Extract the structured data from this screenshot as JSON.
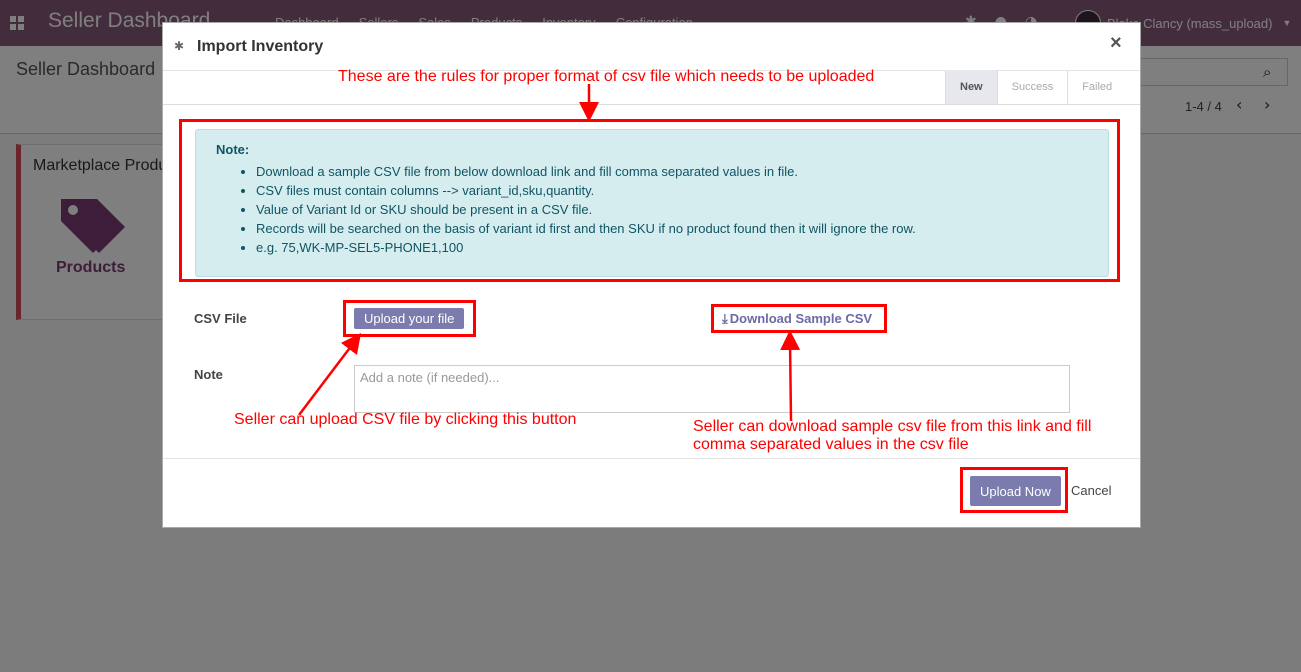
{
  "navbar": {
    "brand": "Seller Dashboard",
    "menu": [
      "Dashboard",
      "Sellers",
      "Sales",
      "Products",
      "Inventory",
      "Configuration"
    ],
    "user": "Blake Clancy (mass_upload)"
  },
  "control": {
    "breadcrumb": "Seller Dashboard",
    "pager": "1-4 / 4"
  },
  "card": {
    "title": "Marketplace Products",
    "label": "Products",
    "accent": "#d34a57"
  },
  "modal": {
    "title": "Import Inventory",
    "close": "×",
    "steps": [
      {
        "label": "New",
        "active": true
      },
      {
        "label": "Success",
        "active": false
      },
      {
        "label": "Failed",
        "active": false
      }
    ],
    "note": {
      "heading": "Note:",
      "items": [
        "Download a sample CSV file from below download link and fill comma separated values in file.",
        "CSV files must contain columns --> variant_id,sku,quantity.",
        "Value of Variant Id or SKU should be present in a CSV file.",
        "Records will be searched on the basis of variant id first and then SKU if no product found then it will ignore the row.",
        "e.g. 75,WK-MP-SEL5-PHONE1,100"
      ]
    },
    "csv_label": "CSV File",
    "upload_file_label": "Upload your file",
    "download_label": "Download Sample CSV",
    "note_label": "Note",
    "note_placeholder": "Add a note (if needed)...",
    "upload_now_label": "Upload Now",
    "cancel_label": "Cancel",
    "button_color": "#7c7bad"
  },
  "annotations": {
    "rules": "These are the rules for proper format of csv file which needs to be uploaded",
    "upload": "Seller can upload CSV file by clicking this button",
    "download_line1": "Seller can download sample csv file from this link and fill",
    "download_line2": "comma separated values in the csv file",
    "color": "#ff0000"
  }
}
